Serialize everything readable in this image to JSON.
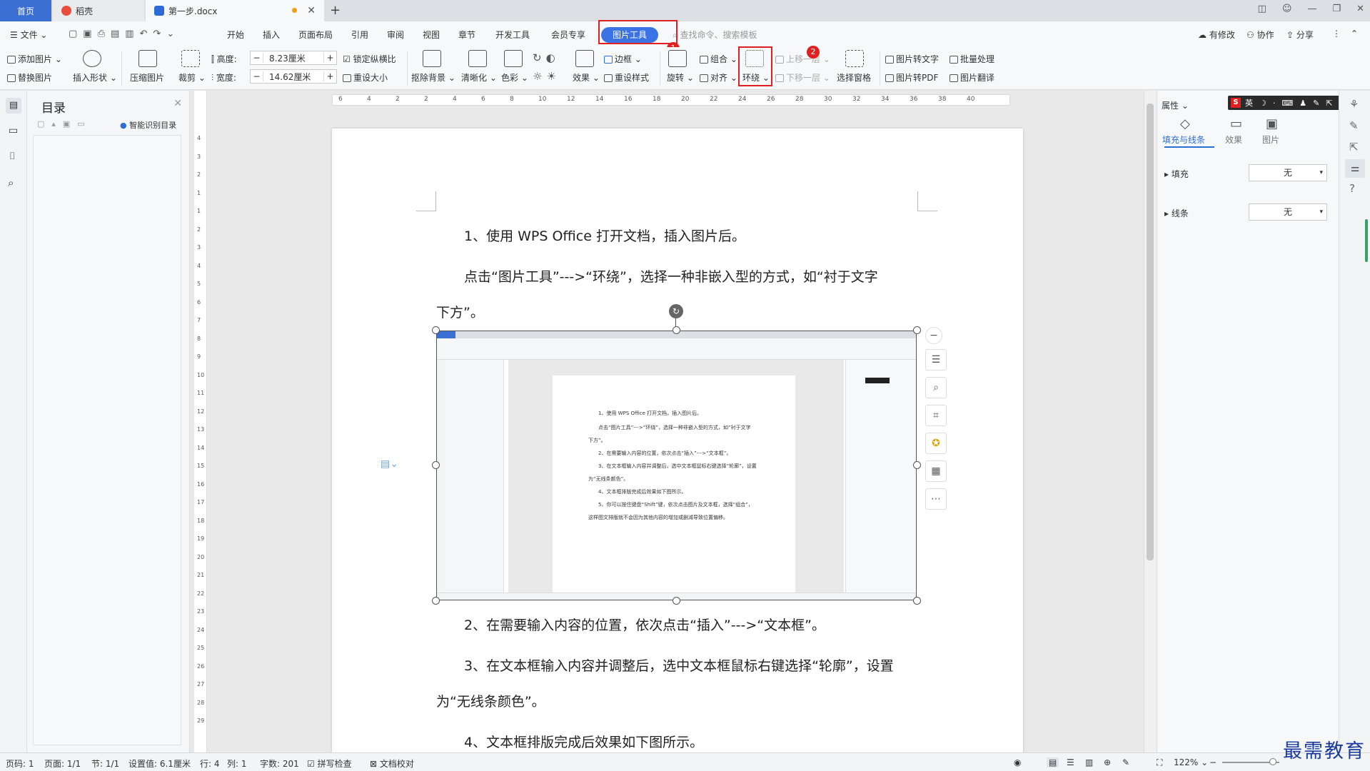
{
  "tabs": {
    "home": "首页",
    "dao": "稻壳",
    "doc": "第一步.docx"
  },
  "menu": {
    "file": "文件",
    "items": [
      "开始",
      "插入",
      "页面布局",
      "引用",
      "审阅",
      "视图",
      "章节",
      "开发工具",
      "会员专享"
    ],
    "picture_tool": "图片工具",
    "search_placeholder": "查找命令、搜索模板",
    "right": [
      "有修改",
      "协作",
      "分享"
    ]
  },
  "annotations": {
    "badge1": "1",
    "badge2": "2"
  },
  "ribbon": {
    "add_picture": "添加图片",
    "replace_picture": "替换图片",
    "insert_shape": "插入形状",
    "compress": "压缩图片",
    "crop": "裁剪",
    "height_label": "高度:",
    "height_value": "8.23厘米",
    "width_label": "宽度:",
    "width_value": "14.62厘米",
    "lock_ratio": "锁定纵横比",
    "reset_size": "重设大小",
    "remove_bg": "抠除背景",
    "sharpen": "清晰化",
    "color": "色彩",
    "effect": "效果",
    "border": "边框",
    "reset_style": "重设样式",
    "rotate": "旋转",
    "group": "组合",
    "align": "对齐",
    "wrap": "环绕",
    "bring_forward": "上移一层",
    "send_backward": "下移一层",
    "selection_pane": "选择窗格",
    "pic_to_text": "图片转文字",
    "pic_to_pdf": "图片转PDF",
    "batch": "批量处理",
    "translate": "图片翻译"
  },
  "nav": {
    "title": "目录",
    "smart": "智能识别目录"
  },
  "ruler_h": [
    "6",
    "4",
    "2",
    "2",
    "4",
    "6",
    "8",
    "10",
    "12",
    "14",
    "16",
    "18",
    "20",
    "22",
    "24",
    "26",
    "28",
    "30",
    "32",
    "34",
    "36",
    "38",
    "40"
  ],
  "ruler_v": [
    "4",
    "3",
    "2",
    "1",
    "1",
    "2",
    "3",
    "4",
    "5",
    "6",
    "7",
    "8",
    "9",
    "10",
    "11",
    "12",
    "13",
    "14",
    "15",
    "16",
    "17",
    "18",
    "19",
    "20",
    "21",
    "22",
    "23",
    "24",
    "25",
    "26",
    "27",
    "28",
    "29"
  ],
  "document": {
    "p1": "1、使用 WPS Office 打开文档，插入图片后。",
    "p2a": "点击“图片工具”--->“环绕”，选择一种非嵌入型的方式，如“衬于文字",
    "p2b": "下方”。",
    "p3": "2、在需要输入内容的位置，依次点击“插入”--->“文本框”。",
    "p4a": "3、在文本框输入内容并调整后，选中文本框鼠标右键选择“轮廓”，设置",
    "p4b": "为“无线条颜色”。",
    "p5": "4、文本框排版完成后效果如下图所示。"
  },
  "mini": {
    "lines": [
      "1、使用 WPS Office 打开文档，插入图片后。",
      "点击“图片工具”--->“环绕”，选择一种非嵌入型的方式，如“衬于文字",
      "下方”。",
      "2、在需要输入内容的位置，依次点击“插入”--->“文本框”。",
      "3、在文本框输入内容并调整后，选中文本框鼠标右键选择“轮廓”，设置",
      "为“无线条颜色”。",
      "4、文本框排版完成后效果如下图所示。",
      "5、你可以按住键盘“Shift”键，依次点击图片及文本框，选择“组合”，",
      "这样图文排版就不会因为其他内容的增加或删减导致位置偏移。"
    ]
  },
  "props": {
    "title": "属性",
    "tabs": [
      "填充与线条",
      "效果",
      "图片"
    ],
    "fill_label": "填充",
    "fill_value": "无",
    "line_label": "线条",
    "line_value": "无"
  },
  "status": {
    "page": "页码: 1",
    "pages": "页面: 1/1",
    "section": "节: 1/1",
    "setting": "设置值: 6.1厘米",
    "row": "行: 4",
    "col": "列: 1",
    "words": "字数: 201",
    "spell": "拼写检查",
    "proof": "文档校对",
    "zoom": "122%"
  },
  "watermark": "最需教育",
  "colors": {
    "accent": "#3b73e4",
    "annotation": "#e02020",
    "tabhome": "#3b6fd4"
  }
}
